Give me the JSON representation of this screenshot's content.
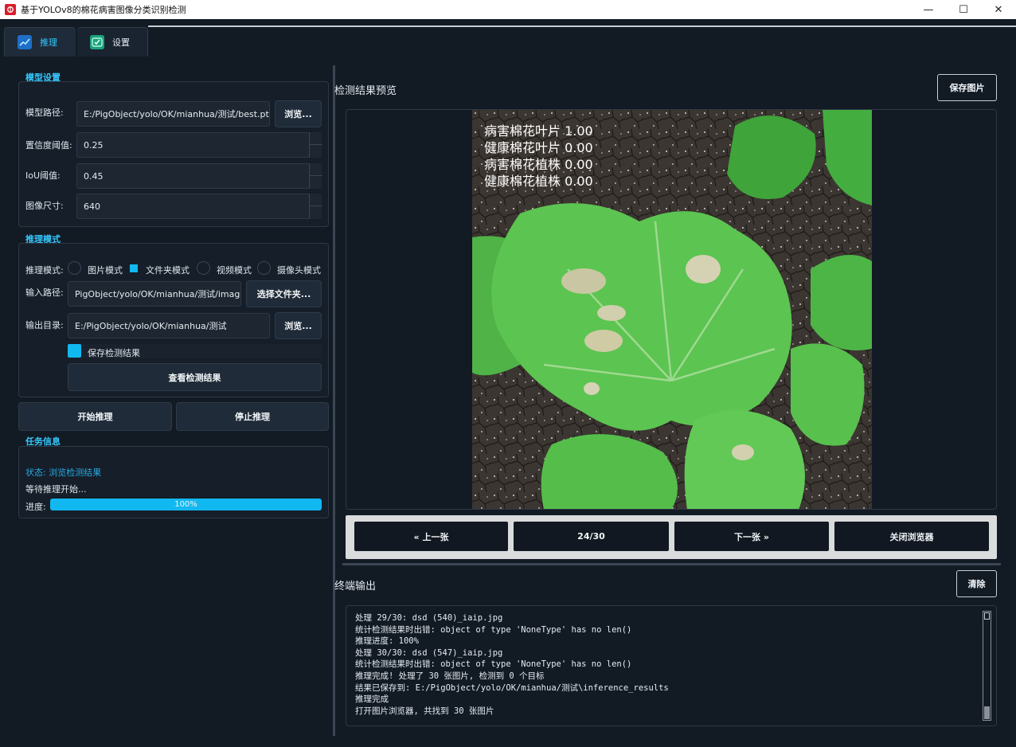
{
  "window": {
    "title": "基于YOLOv8的棉花病害图像分类识别检测",
    "minimize_glyph": "—",
    "maximize_glyph": "☐",
    "close_glyph": "✕"
  },
  "tabs": [
    {
      "label": "推理",
      "icon": "chart-line-icon"
    },
    {
      "label": "设置",
      "icon": "check-icon"
    }
  ],
  "model_settings": {
    "title": "模型设置",
    "model_path_label": "模型路径:",
    "model_path_value": "E:/PigObject/yolo/OK/mianhua/测试/best.pt",
    "browse_label": "浏览...",
    "confidence_label": "置信度阈值:",
    "confidence_value": "0.25",
    "iou_label": "IoU阈值:",
    "iou_value": "0.45",
    "image_size_label": "图像尺寸:",
    "image_size_value": "640"
  },
  "inference_mode": {
    "title": "推理模式",
    "mode_label": "推理模式:",
    "modes": [
      {
        "label": "图片模式",
        "checked": false
      },
      {
        "label": "文件夹模式",
        "checked": true
      },
      {
        "label": "视频模式",
        "checked": false
      },
      {
        "label": "摄像头模式",
        "checked": false
      }
    ],
    "input_path_label": "输入路径:",
    "input_path_value": "PigObject/yolo/OK/mianhua/测试/image",
    "select_folder_label": "选择文件夹...",
    "output_dir_label": "输出目录:",
    "output_dir_value": "E:/PigObject/yolo/OK/mianhua/测试",
    "browse_label": "浏览...",
    "save_results_label": "保存检测结果",
    "view_results_label": "查看检测结果"
  },
  "actions": {
    "start_label": "开始推理",
    "stop_label": "停止推理"
  },
  "task_info": {
    "title": "任务信息",
    "status_text": "状态: 浏览检测结果",
    "waiting_text": "等待推理开始...",
    "progress_label": "进度:",
    "progress_value": 100,
    "progress_text": "100%"
  },
  "preview": {
    "title": "检测结果预览",
    "save_image_label": "保存图片",
    "overlay_lines": [
      "病害棉花叶片 1.00",
      "健康棉花叶片 0.00",
      "病害棉花植株 0.00",
      "健康棉花植株 0.00"
    ]
  },
  "navigation": {
    "prev_label": "« 上一张",
    "counter": "24/30",
    "next_label": "下一张 »",
    "close_label": "关闭浏览器"
  },
  "terminal": {
    "title": "终端输出",
    "clear_label": "清除",
    "lines": [
      "处理 29/30: dsd (540)_iaip.jpg",
      "统计检测结果时出错: object of type 'NoneType' has no len()",
      "推理进度: 100%",
      "处理 30/30: dsd (547)_iaip.jpg",
      "统计检测结果时出错: object of type 'NoneType' has no len()",
      "推理完成! 处理了 30 张图片, 检测到 0 个目标",
      "结果已保存到: E:/PigObject/yolo/OK/mianhua/测试\\inference_results",
      "推理完成",
      "打开图片浏览器, 共找到 30 张图片"
    ]
  },
  "colors": {
    "accent": "#12b8f0",
    "background": "#121a24"
  }
}
